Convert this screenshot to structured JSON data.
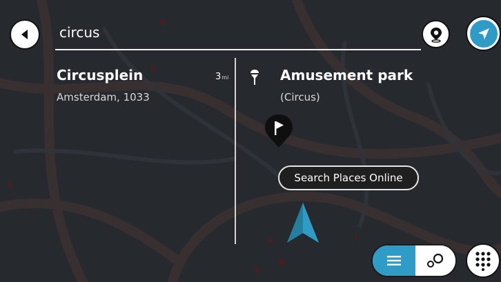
{
  "search": {
    "query": "circus"
  },
  "results": [
    {
      "name": "Circusplein",
      "detail": "Amsterdam, 1033",
      "distance": "3",
      "distance_unit": "mi"
    },
    {
      "name": "Amusement park",
      "detail": "(Circus)",
      "category_icon": "amusement-park-icon"
    }
  ],
  "actions": {
    "search_places_online": "Search Places Online"
  },
  "icons": {
    "back": "back-arrow-icon",
    "location_pin": "location-pin-icon",
    "current_location": "navigation-arrow-icon",
    "list_view": "list-icon",
    "map_view": "map-pins-icon",
    "keypad": "keypad-icon",
    "flag_marker": "flag-pin-icon",
    "car_chevron": "car-position-icon"
  },
  "colors": {
    "accent": "#2e9cc7",
    "background": "#2a2d30",
    "marker": "#0f0f0f"
  }
}
